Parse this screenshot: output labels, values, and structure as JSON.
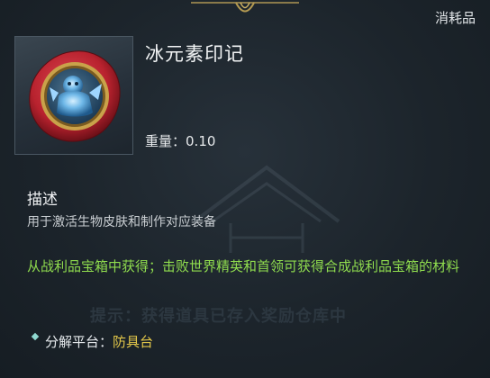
{
  "tooltip": {
    "category": "消耗品",
    "item_name": "冰元素印记",
    "weight_label": "重量：",
    "weight_value": "0.10",
    "description_title": "描述",
    "description_text": "用于激活生物皮肤和制作对应装备",
    "source_text": "从战利品宝箱中获得；击败世界精英和首领可获得合成战利品宝箱的材料",
    "ghost_hint": "提示：获得道具已存入奖励仓库中",
    "dismantle_label": "分解平台：",
    "dismantle_value": "防具台"
  },
  "icon": {
    "name": "ice-element-seal-icon"
  },
  "colors": {
    "source_text": "#8fdc4e",
    "dismantle_value": "#e4c84a",
    "seal_red": "#b8222e",
    "seal_gold": "#c9a24a",
    "ice_blue": "#6fb8e8"
  }
}
